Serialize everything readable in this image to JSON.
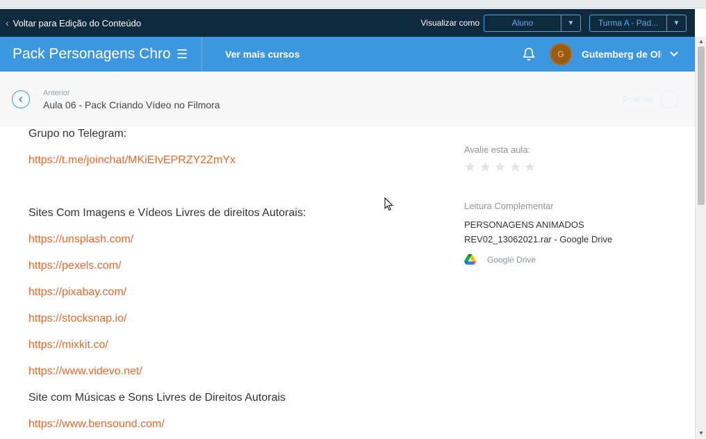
{
  "admin_bar": {
    "back_label": "Voltar para Edição do Conteúdo",
    "view_as_label": "Visualizar como",
    "view_as_value": "Aluno",
    "class_value": "Turma A - Pad..."
  },
  "nav": {
    "course_title": "Pack Personagens Chroma Key",
    "more_courses": "Ver mais cursos",
    "avatar_initial": "G",
    "user_name": "Gutemberg de Oliveira"
  },
  "lesson_nav": {
    "prev_label": "Anterior",
    "prev_title": "Aula 06 - Pack Criando Vídeo no Filmora",
    "next_label": "Próximo"
  },
  "content": {
    "lines": [
      {
        "kind": "text",
        "value": "Grupo no Telegram:"
      },
      {
        "kind": "link",
        "value": "https://t.me/joinchat/MKiEIvEPRZY2ZmYx"
      },
      {
        "kind": "text",
        "value": "Sites Com Imagens e Vídeos Livres de direitos Autorais:"
      },
      {
        "kind": "link",
        "value": "https://unsplash.com/"
      },
      {
        "kind": "link",
        "value": "https://pexels.com/"
      },
      {
        "kind": "link",
        "value": "https://pixabay.com/"
      },
      {
        "kind": "link",
        "value": "https://stocksnap.io/"
      },
      {
        "kind": "link",
        "value": "https://mixkit.co/"
      },
      {
        "kind": "link",
        "value": "https://www.videvo.net/"
      },
      {
        "kind": "text",
        "value": "Site com Músicas e Sons Livres de Direitos Autorais"
      },
      {
        "kind": "link",
        "value": "https://www.bensound.com/"
      }
    ]
  },
  "sidebar": {
    "rate_label": "Avalie esta aula:",
    "rating": 0,
    "rating_max": 5,
    "reading_label": "Leitura Complementar",
    "file_name": "PERSONAGENS ANIMADOS REV02_13062021.rar - Google Drive",
    "drive_label": "Google Drive"
  },
  "colors": {
    "admin_bar": "#0f2a3c",
    "nav_bar": "#3d97e0",
    "link": "#e8692a",
    "avatar": "#9b5a12"
  }
}
